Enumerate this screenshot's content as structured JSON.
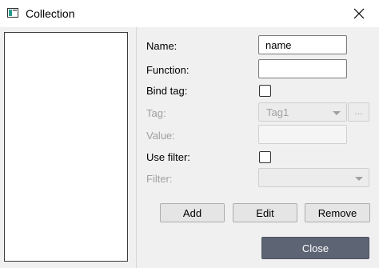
{
  "window": {
    "title": "Collection"
  },
  "form": {
    "name_label": "Name:",
    "name_value": "name",
    "function_label": "Function:",
    "function_value": "",
    "bind_tag_label": "Bind tag:",
    "bind_tag_checked": false,
    "tag_label": "Tag:",
    "tag_value": "Tag1",
    "tag_browse_label": "...",
    "value_label": "Value:",
    "value_value": "",
    "use_filter_label": "Use filter:",
    "use_filter_checked": false,
    "filter_label": "Filter:",
    "filter_value": ""
  },
  "buttons": {
    "add": "Add",
    "edit": "Edit",
    "remove": "Remove",
    "close": "Close"
  },
  "colors": {
    "close_button_bg": "#5d6474",
    "disabled_text": "#a0a0a0"
  }
}
